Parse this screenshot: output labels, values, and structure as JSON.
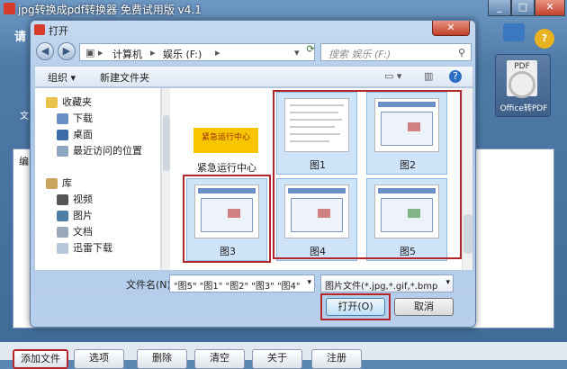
{
  "app": {
    "title": "jpg转换成pdf转换器 免费试用版 v4.1",
    "left_label": "请",
    "left_icon_label": "文",
    "feature_tile_doc": "PDF",
    "feature_label": "Office转PDF",
    "list_header": "编",
    "window_controls": [
      "_",
      "□",
      "✕"
    ],
    "bottom_buttons": [
      "添加文件",
      "选项",
      "删除",
      "清空",
      "关于",
      "注册"
    ]
  },
  "dialog": {
    "title": "打开",
    "close": "✕",
    "nav": {
      "back": "◀",
      "forward": "▶"
    },
    "breadcrumb": [
      "计算机",
      "娱乐 (F:)"
    ],
    "search_placeholder": "搜索 娱乐 (F:)",
    "toolbar": {
      "organize": "组织 ▾",
      "new_folder": "新建文件夹"
    },
    "nav_pane": [
      {
        "label": "收藏夹",
        "icon": "star-icon"
      },
      {
        "label": "下载",
        "icon": "download-folder-icon"
      },
      {
        "label": "桌面",
        "icon": "desktop-icon"
      },
      {
        "label": "最近访问的位置",
        "icon": "recent-places-icon"
      },
      {
        "label": "库",
        "icon": "library-icon"
      },
      {
        "label": "视频",
        "icon": "video-icon"
      },
      {
        "label": "图片",
        "icon": "pictures-icon"
      },
      {
        "label": "文档",
        "icon": "documents-icon"
      },
      {
        "label": "迅雷下载",
        "icon": "thunder-download-icon"
      }
    ],
    "files": [
      {
        "label": "紧急运行中心",
        "thumb_text": "紧急运行中心"
      },
      {
        "label": "图1"
      },
      {
        "label": "图2"
      },
      {
        "label": "图3"
      },
      {
        "label": "图4"
      },
      {
        "label": "图5"
      }
    ],
    "filename_label": "文件名(N):",
    "filename_value": "\"图5\" \"图1\" \"图2\" \"图3\" \"图4\"",
    "filetype_value": "图片文件(*.jpg,*.gif,*.bmp,*.p",
    "open_button": "打开(O)",
    "cancel_button": "取消"
  },
  "colors": {
    "highlight_red": "#b3262c",
    "selection_blue": "#cfe3f9"
  }
}
